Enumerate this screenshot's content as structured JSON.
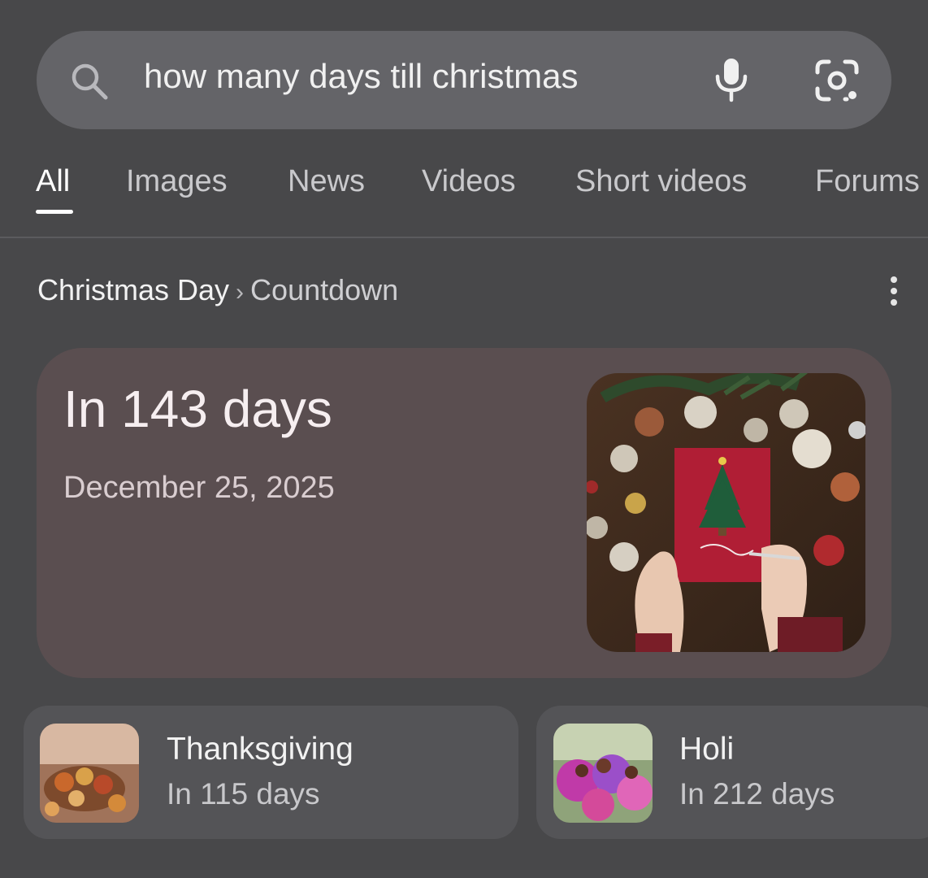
{
  "search": {
    "query": "how many days till christmas",
    "icons": {
      "search": "search-icon",
      "voice": "mic-icon",
      "lens": "google-lens-icon"
    }
  },
  "tabs": [
    {
      "label": "All",
      "active": true
    },
    {
      "label": "Images",
      "active": false
    },
    {
      "label": "News",
      "active": false
    },
    {
      "label": "Videos",
      "active": false
    },
    {
      "label": "Short videos",
      "active": false
    },
    {
      "label": "Forums",
      "active": false
    }
  ],
  "breadcrumb": {
    "parent": "Christmas Day",
    "separator": "›",
    "current": "Countdown",
    "menu_icon": "more-vert-icon"
  },
  "countdown": {
    "title": "In 143 days",
    "date": "December 25, 2025",
    "image": "merry-christmas-card-photo"
  },
  "related_events": [
    {
      "name": "Thanksgiving",
      "days": "In 115 days",
      "image": "thanksgiving-photo"
    },
    {
      "name": "Holi",
      "days": "In 212 days",
      "image": "holi-photo"
    }
  ],
  "colors": {
    "background": "#48484a",
    "search_bar": "#646468",
    "countdown_card": "#5a4e50",
    "event_card": "#545457"
  }
}
